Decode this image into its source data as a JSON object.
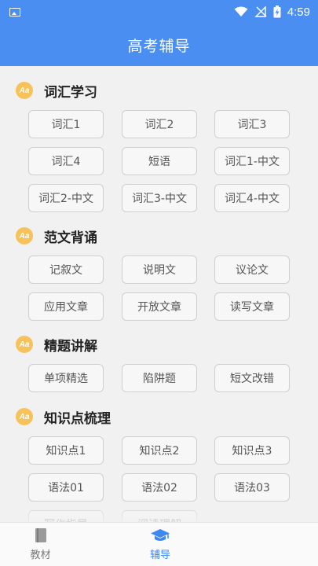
{
  "status_bar": {
    "time": "4:59",
    "icons": [
      "image-icon",
      "wifi-icon",
      "no-signal-icon",
      "battery-charging-icon"
    ]
  },
  "app_bar": {
    "title": "高考辅导"
  },
  "sections": [
    {
      "title": "词汇学习",
      "icon": "aa-icon",
      "items": [
        "词汇1",
        "词汇2",
        "词汇3",
        "词汇4",
        "短语",
        "词汇1-中文",
        "词汇2-中文",
        "词汇3-中文",
        "词汇4-中文"
      ]
    },
    {
      "title": "范文背诵",
      "icon": "aa-icon",
      "items": [
        "记叙文",
        "说明文",
        "议论文",
        "应用文章",
        "开放文章",
        "读写文章"
      ]
    },
    {
      "title": "精题讲解",
      "icon": "aa-icon",
      "items": [
        "单项精选",
        "陷阱题",
        "短文改错"
      ]
    },
    {
      "title": "知识点梳理",
      "icon": "aa-icon",
      "items": [
        "知识点1",
        "知识点2",
        "知识点3",
        "语法01",
        "语法02",
        "语法03",
        "写作指导",
        "阅读理解"
      ]
    }
  ],
  "bottom_nav": {
    "tabs": [
      {
        "label": "教材",
        "icon": "book-icon",
        "active": false
      },
      {
        "label": "辅导",
        "icon": "graduation-cap-icon",
        "active": true
      }
    ],
    "active_color": "#3f88f2",
    "inactive_color": "#7a7a7a"
  },
  "colors": {
    "primary": "#4a8ef1",
    "background": "#f1f1f1",
    "icon_badge": "#f7c25a"
  }
}
